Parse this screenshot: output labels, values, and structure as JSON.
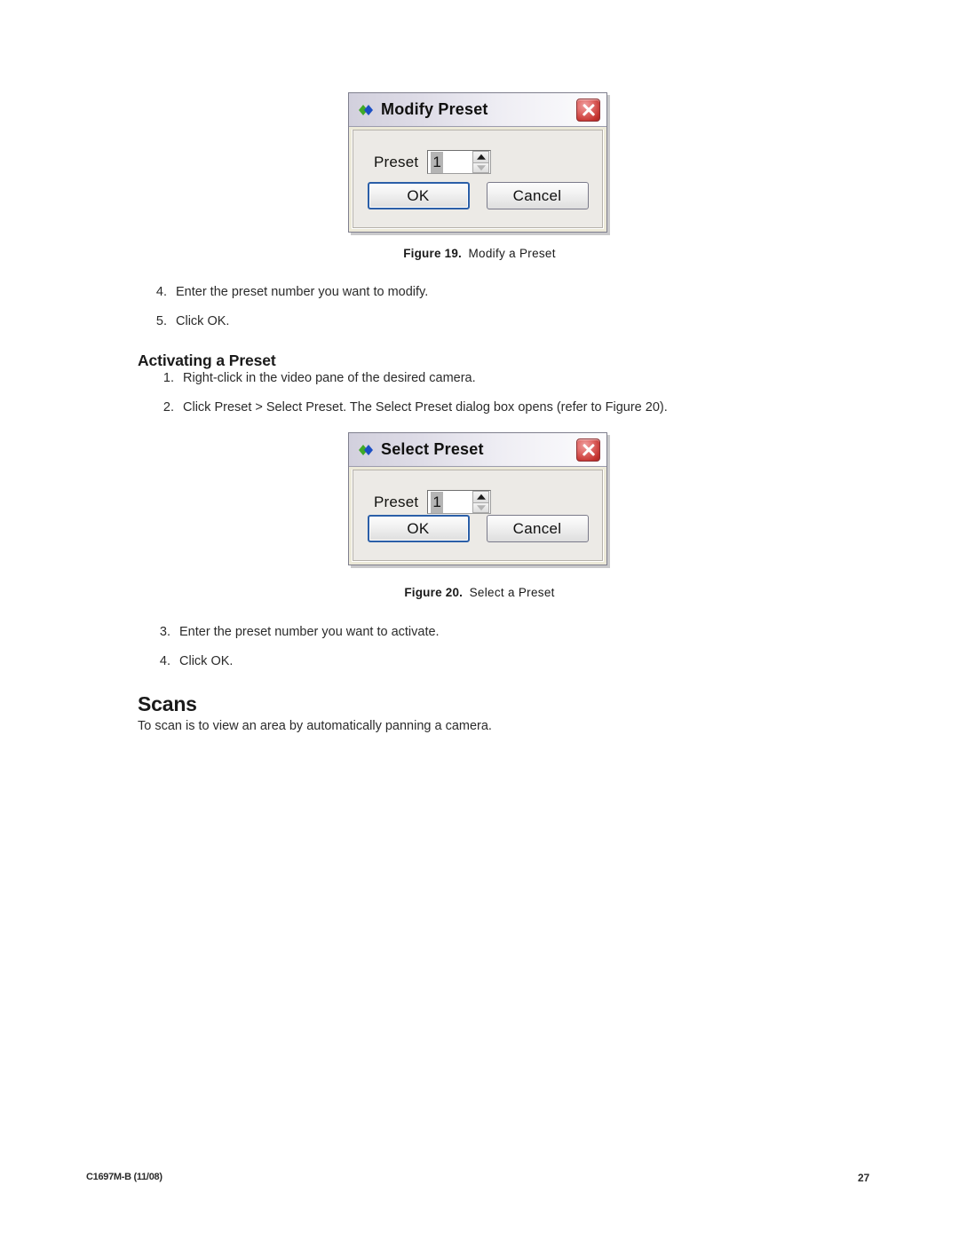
{
  "document": {
    "footer_left": "C1697M-B (11/08)",
    "page_number": "27"
  },
  "figure19": {
    "caption_label": "Figure 19.",
    "caption_text": "Modify a Preset",
    "dialog": {
      "title": "Modify Preset",
      "icon": "diamond-icon",
      "close_icon": "close-icon",
      "field_label": "Preset",
      "field_value": "1",
      "spinner_up_icon": "spin-up-icon",
      "spinner_down_icon": "spin-down-icon",
      "ok_label": "OK",
      "cancel_label": "Cancel"
    }
  },
  "figure20": {
    "caption_label": "Figure 20.",
    "caption_text": "Select a Preset",
    "dialog": {
      "title": "Select Preset",
      "icon": "diamond-icon",
      "close_icon": "close-icon",
      "field_label": "Preset",
      "field_value": "1",
      "spinner_up_icon": "spin-up-icon",
      "spinner_down_icon": "spin-down-icon",
      "ok_label": "OK",
      "cancel_label": "Cancel"
    }
  },
  "steps_modify": [
    {
      "num": "4.",
      "text": "Enter the preset number you want to modify."
    },
    {
      "num": "5.",
      "text": "Click OK."
    }
  ],
  "section_activating": {
    "heading": "Activating a Preset",
    "steps": [
      {
        "num": "1.",
        "text": "Right-click in the video pane of the desired camera."
      },
      {
        "num": "2.",
        "text": "Click Preset > Select Preset. The Select Preset dialog box opens (refer to Figure 20)."
      }
    ]
  },
  "steps_select": [
    {
      "num": "3.",
      "text": "Enter the preset number you want to activate."
    },
    {
      "num": "4.",
      "text": "Click OK."
    }
  ],
  "section_scans": {
    "heading": "Scans",
    "paragraph": "To scan is to view an area by automatically panning a camera."
  },
  "colors": {
    "close_button": "#c4332f",
    "default_button_border": "#2b5fa8",
    "icon_green": "#3faa28",
    "icon_blue": "#1b4fc4"
  }
}
